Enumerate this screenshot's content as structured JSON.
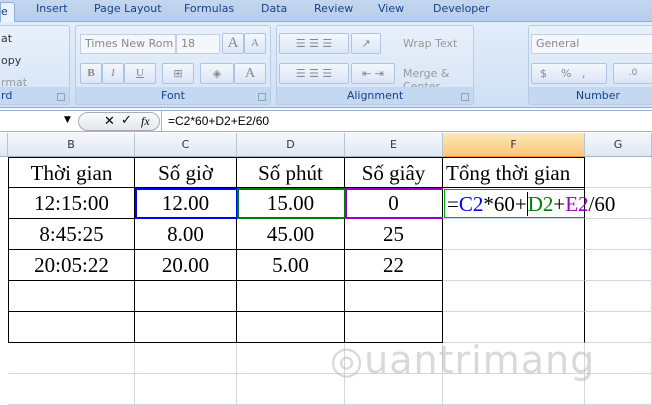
{
  "tabs": [
    "e",
    "Insert",
    "Page Layout",
    "Formulas",
    "Data",
    "Review",
    "View",
    "Developer"
  ],
  "clipboard": {
    "items": [
      "at",
      "opy",
      "rmat Painter"
    ],
    "label": "rd"
  },
  "font": {
    "name": "Times New Rom",
    "size": "18",
    "label": "Font",
    "bold": "B",
    "italic": "I",
    "underline": "U",
    "grow": "A",
    "shrink": "A",
    "color": "A"
  },
  "alignment": {
    "wrap": "Wrap Text",
    "merge": "Merge & Center",
    "label": "Alignment"
  },
  "number": {
    "format": "General",
    "currency": "$",
    "percent": "%",
    "comma": ",",
    "inc": ".0",
    "label": "Number"
  },
  "formula_bar": {
    "fx": "fx",
    "formula": "=C2*60+D2+E2/60"
  },
  "columns": [
    "B",
    "C",
    "D",
    "E",
    "F",
    "G"
  ],
  "rows": [
    [
      "Thời gian",
      "Số giờ",
      "Số phút",
      "Số giây",
      "Tổng thời gian"
    ],
    [
      "12:15:00",
      "12.00",
      "15.00",
      "0",
      ""
    ],
    [
      "8:45:25",
      "8.00",
      "45.00",
      "25",
      ""
    ],
    [
      "20:05:22",
      "20.00",
      "5.00",
      "22",
      ""
    ],
    [
      "",
      "",
      "",
      "",
      ""
    ],
    [
      "",
      "",
      "",
      "",
      ""
    ]
  ],
  "edit_formula": {
    "p1": "=",
    "c2": "C2",
    "p2": "*60+",
    "d2": "D2",
    "p3": "+",
    "e2": "E2",
    "p4": "/60"
  },
  "colors": {
    "c_ref": "#0000ff",
    "d_ref": "#008000",
    "e_ref": "#9900cc"
  },
  "watermark": "Quantrimang"
}
